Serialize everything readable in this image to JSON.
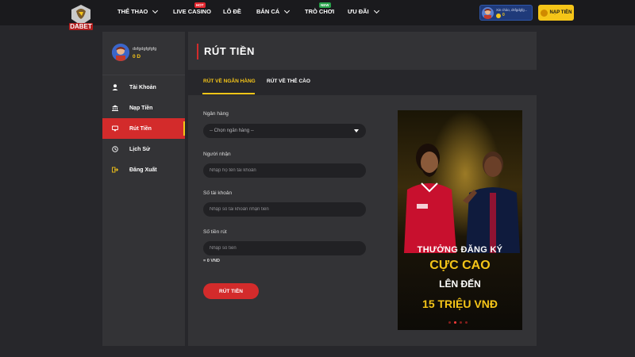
{
  "header": {
    "logo_text": "DABET",
    "nav": [
      {
        "label": "THỂ THAO",
        "has_chevron": true
      },
      {
        "label": "LIVE CASINO",
        "badge": "HOT"
      },
      {
        "label": "LÔ ĐỀ"
      },
      {
        "label": "BẮN CÁ",
        "has_chevron": true
      },
      {
        "label": "TRÒ CHƠI",
        "badge": "NEW"
      },
      {
        "label": "ƯU ĐÃI",
        "has_chevron": true
      }
    ],
    "user": {
      "greeting": "Xin chào, dsfgdgfg...",
      "balance": "0"
    },
    "deposit_label": "NẠP TIỀN"
  },
  "sidebar": {
    "username": "dsfgdgfgfgfg",
    "balance": "0 D",
    "items": [
      {
        "label": "Tài Khoản",
        "icon": "user-icon"
      },
      {
        "label": "Nạp Tiền",
        "icon": "bank-icon"
      },
      {
        "label": "Rút Tiền",
        "icon": "withdraw-icon",
        "active": true
      },
      {
        "label": "Lịch Sử",
        "icon": "history-icon"
      },
      {
        "label": "Đăng Xuất",
        "icon": "logout-icon"
      }
    ]
  },
  "main": {
    "title": "RÚT TIỀN",
    "tabs": [
      {
        "label": "RÚT VỀ NGÂN HÀNG",
        "active": true
      },
      {
        "label": "RÚT VỀ THẺ CÀO"
      }
    ],
    "form": {
      "bank_label": "Ngân hàng",
      "bank_select": "-- Chọn ngân hàng --",
      "recipient_label": "Người nhận",
      "recipient_placeholder": "Nhập họ tên tài khoản",
      "account_label": "Số tài khoản",
      "account_placeholder": "Nhập số tài khoản nhận tiền",
      "amount_label": "Số tiền rút",
      "amount_placeholder": "Nhập số tiền",
      "approx": "= 0 VND",
      "submit_label": "RÚT TIỀN"
    },
    "banner": {
      "line1": "THƯỞNG ĐĂNG KÝ",
      "line2": "CỰC CAO",
      "line3": "LÊN ĐẾN",
      "line4": "15 TRIỆU VNĐ",
      "active_dot": 2,
      "dot_count": 4
    }
  },
  "colors": {
    "accent_red": "#d32b2b",
    "accent_yellow": "#f5c518",
    "background": "#27272b",
    "panel": "#333336"
  }
}
